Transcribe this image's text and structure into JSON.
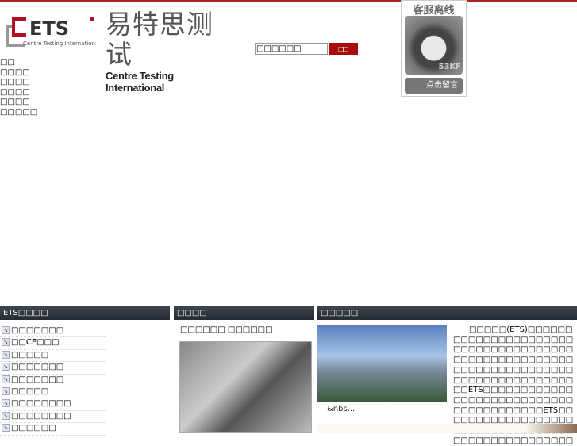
{
  "header": {
    "brand_cn": "易特思测试",
    "brand_en": "Centre Testing International",
    "logo_text": "ETS",
    "logo_sub": "Centre Testing International",
    "search_placeholder": "□□□□□□",
    "search_button": "□□"
  },
  "nav": [
    "□□",
    "□□□□",
    "□□□□",
    "□□□□",
    "□□□□",
    "□□□□□"
  ],
  "customer_service": {
    "title": "客服离线",
    "badge": "53KF",
    "message_button": "点击留言"
  },
  "sections": {
    "services": {
      "title": "ETS□□□□",
      "items": [
        "□□□□□□□",
        "□□CE□□□",
        "□□□□□",
        "□□□□□□□",
        "□□□□□□□",
        "□□□□□",
        "□□□□□□□□",
        "□□□□□□□□",
        "□□□□□□"
      ]
    },
    "news": {
      "title": "□□□□",
      "headline": "□□□□□□ □□□□□□"
    },
    "about": {
      "title": "□□□□□",
      "text": "□□□□□(ETS)□□□□□□□□□□□□□□□□□□□□□□□□□□□□□□□□□□□□□□□□□□□□□□□□□□□□□□□□□□□□□□□□□□□□□□□□□□□□□□□□□□□□□□□□ETS□□□□□□□□□□□□□□□□□□□□□□□□□□□□□□□□□□□□□□□□ETS□□□□□□□□□□□□□□□□□□□□□□□□□□□□□□□□□□□□□□□□□□□□□□□□□□",
      "more": "&nbs..."
    }
  }
}
